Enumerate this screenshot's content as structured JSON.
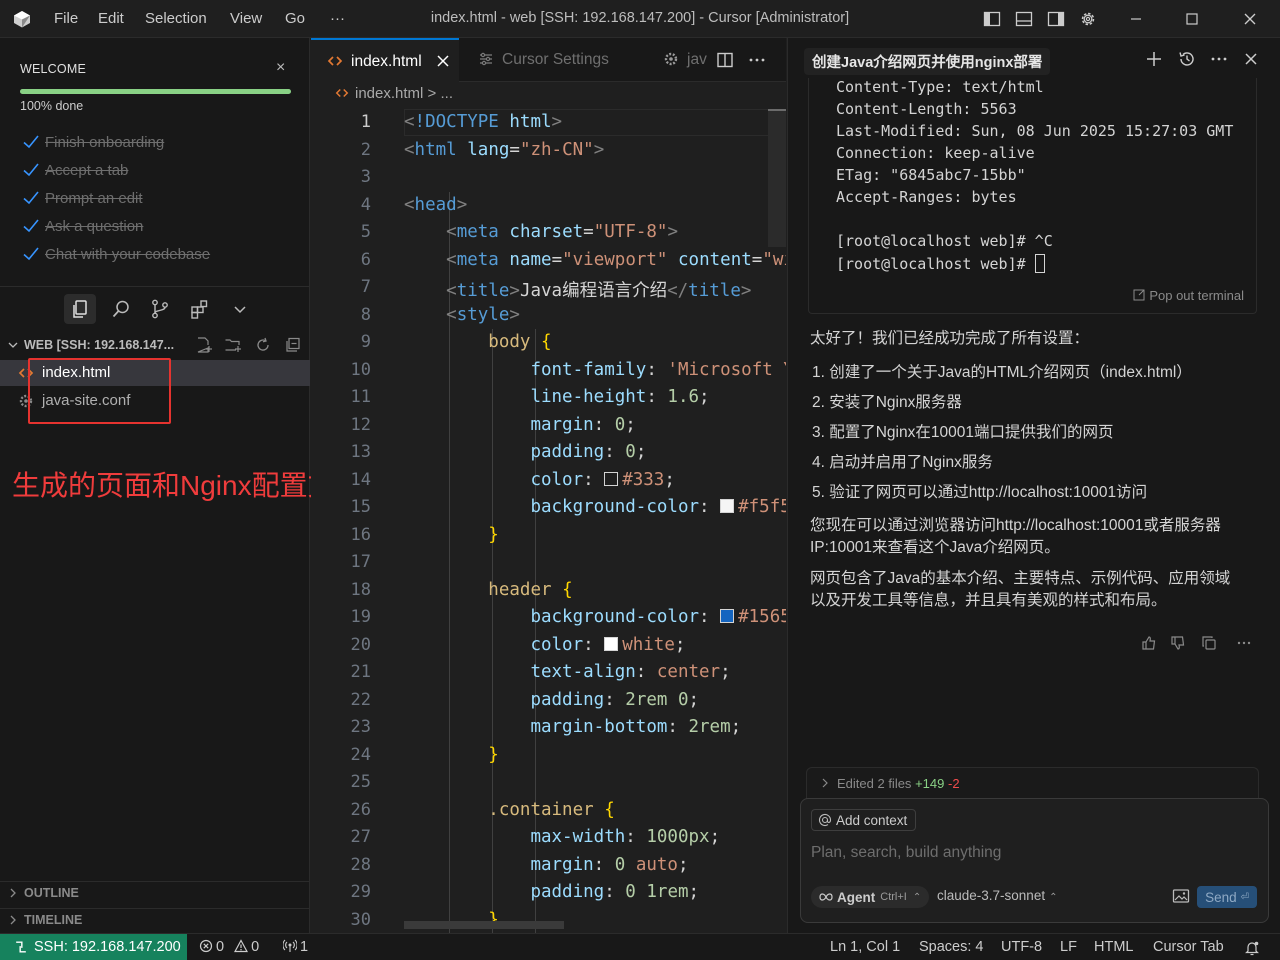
{
  "titlebar": {
    "menu": [
      "File",
      "Edit",
      "Selection",
      "View",
      "Go"
    ],
    "more": "···",
    "title": "index.html - web [SSH: 192.168.147.200] - Cursor [Administrator]"
  },
  "welcome": {
    "title": "WELCOME",
    "progress_label": "100% done",
    "progress_fraction": 1.0,
    "checklist": [
      "Finish onboarding",
      "Accept a tab",
      "Prompt an edit",
      "Ask a question",
      "Chat with your codebase"
    ]
  },
  "explorer": {
    "root_label": "WEB [SSH: 192.168.147...",
    "files": [
      {
        "name": "index.html",
        "icon": "html-file-icon",
        "active": true
      },
      {
        "name": "java-site.conf",
        "icon": "gear-file-icon",
        "active": false
      }
    ],
    "outline_label": "OUTLINE",
    "timeline_label": "TIMELINE"
  },
  "annotation": {
    "text": "生成的页面和Nginx配置文件",
    "color": "#f03c3c"
  },
  "editor": {
    "tabs": [
      {
        "label": "index.html",
        "icon": "html-file-icon",
        "active": true
      },
      {
        "label": "Cursor Settings",
        "icon": "settings-icon",
        "active": false
      },
      {
        "label": "jav",
        "icon": "gear-icon",
        "active": false
      }
    ],
    "breadcrumb": {
      "file": "index.html",
      "sep": ">",
      "rest": "..."
    },
    "current_line": 1
  },
  "chat": {
    "title": "创建Java介绍网页并使用nginx部署",
    "terminal_lines": [
      "Content-Type: text/html",
      "Content-Length: 5563",
      "Last-Modified: Sun, 08 Jun 2025 15:27:03 GMT",
      "Connection: keep-alive",
      "ETag: \"6845abc7-15bb\"",
      "Accept-Ranges: bytes",
      "",
      "[root@localhost web]# ^C",
      "[root@localhost web]# "
    ],
    "popout_label": "Pop out terminal",
    "intro": "太好了！我们已经成功完成了所有设置：",
    "steps": [
      "1. 创建了一个关于Java的HTML介绍网页（index.html）",
      "2. 安装了Nginx服务器",
      "3. 配置了Nginx在10001端口提供我们的网页",
      "4. 启动并启用了Nginx服务",
      "5. 验证了网页可以通过http://localhost:10001访问"
    ],
    "para1_line1": "您现在可以通过浏览器访问http://localhost:10001或者服务器",
    "para1_line2": "IP:10001来查看这个Java介绍网页。",
    "para2_line1": "网页包含了Java的基本介绍、主要特点、示例代码、应用领域",
    "para2_line2": "以及开发工具等信息，并且具有美观的样式和布局。",
    "edited": {
      "label": "Edited 2 files",
      "added": "+149",
      "removed": "-2"
    },
    "composer": {
      "add_context": "Add context",
      "placeholder": "Plan, search, build anything",
      "agent_label": "Agent",
      "agent_shortcut": "Ctrl+I",
      "model": "claude-3.7-sonnet",
      "send_label": "Send"
    }
  },
  "statusbar": {
    "remote": "SSH: 192.168.147.200",
    "errors": "0",
    "warnings": "0",
    "ports": "1",
    "position": "Ln 1, Col 1",
    "spaces": "Spaces: 4",
    "encoding": "UTF-8",
    "eol": "LF",
    "language": "HTML",
    "cursor_tab": "Cursor Tab"
  },
  "colors": {
    "accent": "#0078d4",
    "remote_bg": "#16825d",
    "progress": "#89d185"
  }
}
